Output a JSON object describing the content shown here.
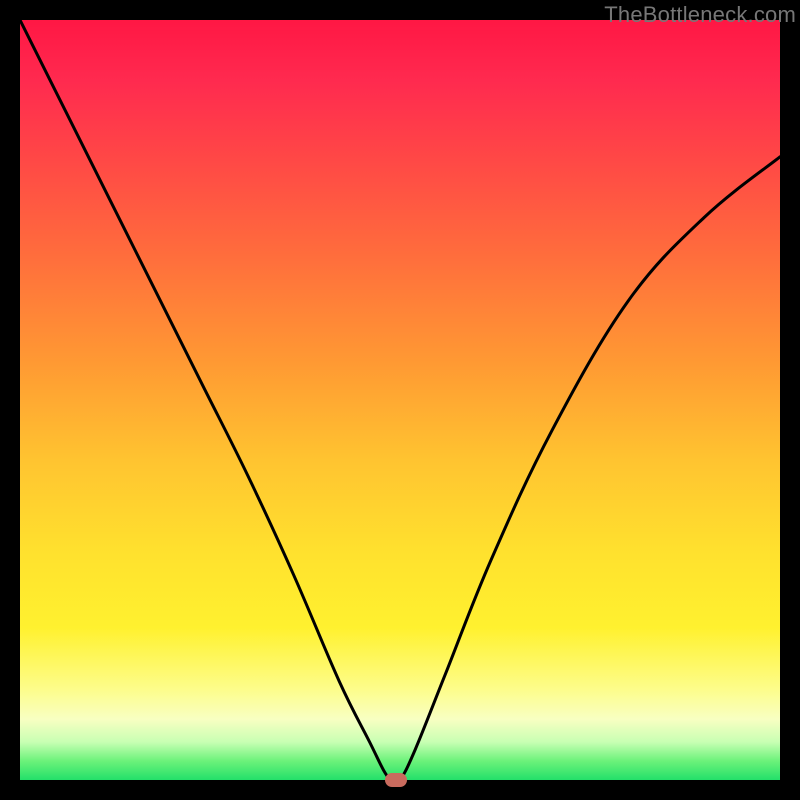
{
  "watermark": "TheBottleneck.com",
  "colors": {
    "frame": "#000000",
    "gradient_top": "#ff1744",
    "gradient_mid": "#ffe12e",
    "gradient_bottom": "#23e06a",
    "curve_stroke": "#000000",
    "marker_fill": "#c96b5e"
  },
  "chart_data": {
    "type": "line",
    "title": "",
    "xlabel": "",
    "ylabel": "",
    "xlim": [
      0,
      100
    ],
    "ylim": [
      0,
      100
    ],
    "grid": false,
    "legend": false,
    "series": [
      {
        "name": "bottleneck-curve",
        "x": [
          0,
          6,
          12,
          18,
          24,
          30,
          36,
          42,
          46,
          48,
          49,
          50,
          52,
          56,
          62,
          70,
          80,
          90,
          100
        ],
        "values": [
          100,
          88,
          76,
          64,
          52,
          40,
          27,
          13,
          5,
          1,
          0,
          0,
          4,
          14,
          29,
          46,
          63,
          74,
          82
        ]
      }
    ],
    "annotations": [
      {
        "name": "minimum-marker",
        "x": 49.5,
        "y": 0
      }
    ]
  }
}
